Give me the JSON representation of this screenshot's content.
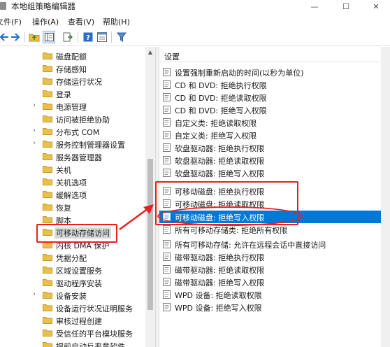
{
  "window": {
    "title": "本地组策略编辑器",
    "min_glyph": "—",
    "max_glyph": "☐",
    "close_glyph": "✕"
  },
  "menu": [
    {
      "label": "文件(F)"
    },
    {
      "label": "操作(A)"
    },
    {
      "label": "查看(V)"
    },
    {
      "label": "帮助(H)"
    }
  ],
  "toolbar": {
    "buttons": [
      "back-icon",
      "forward-icon",
      "up-folder-icon",
      "show-hide-tree-icon",
      "export-list-icon",
      "help-icon",
      "properties-icon",
      "filter-icon"
    ]
  },
  "tree": {
    "items": [
      {
        "label": "磁盘配额",
        "expandable": false
      },
      {
        "label": "存储感知",
        "expandable": false
      },
      {
        "label": "存储运行状况",
        "expandable": false
      },
      {
        "label": "登录",
        "expandable": false
      },
      {
        "label": "电源管理",
        "expandable": true
      },
      {
        "label": "访问被拒绝协助",
        "expandable": false
      },
      {
        "label": "分布式 COM",
        "expandable": true
      },
      {
        "label": "服务控制管理器设置",
        "expandable": true
      },
      {
        "label": "服务器管理器",
        "expandable": false
      },
      {
        "label": "关机",
        "expandable": false
      },
      {
        "label": "关机选项",
        "expandable": false
      },
      {
        "label": "缓解选项",
        "expandable": false
      },
      {
        "label": "恢复",
        "expandable": false
      },
      {
        "label": "脚本",
        "expandable": false
      },
      {
        "label": "可移动存储访问",
        "expandable": false,
        "selected": true
      },
      {
        "label": "内核 DMA 保护",
        "expandable": false
      },
      {
        "label": "凭据分配",
        "expandable": false
      },
      {
        "label": "区域设置服务",
        "expandable": false
      },
      {
        "label": "驱动程序安装",
        "expandable": false
      },
      {
        "label": "设备安装",
        "expandable": true
      },
      {
        "label": "设备运行状况证明服务",
        "expandable": false
      },
      {
        "label": "审核过程创建",
        "expandable": false
      },
      {
        "label": "受信任的平台模块服务",
        "expandable": false
      },
      {
        "label": "提前启动反恶意软件",
        "expandable": false
      }
    ]
  },
  "settings": {
    "header": "设置",
    "items": [
      {
        "label": "设置强制重新启动的时间(以秒为单位)"
      },
      {
        "label": "CD 和 DVD: 拒绝执行权限"
      },
      {
        "label": "CD 和 DVD: 拒绝读取权限"
      },
      {
        "label": "CD 和 DVD: 拒绝写入权限"
      },
      {
        "label": "自定义类: 拒绝读取权限"
      },
      {
        "label": "自定义类: 拒绝写入权限"
      },
      {
        "label": "软盘驱动器: 拒绝执行权限"
      },
      {
        "label": "软盘驱动器: 拒绝读取权限"
      },
      {
        "label": "软盘驱动器: 拒绝写入权限"
      },
      {
        "label": "可移动磁盘: 拒绝执行权限"
      },
      {
        "label": "可移动磁盘: 拒绝读取权限"
      },
      {
        "label": "可移动磁盘: 拒绝写入权限",
        "selected": true
      },
      {
        "label": "所有可移动存储类: 拒绝所有权限"
      },
      {
        "label": "所有可移动存储: 允许在远程会话中直接访问"
      },
      {
        "label": "磁带驱动器: 拒绝执行权限"
      },
      {
        "label": "磁带驱动器: 拒绝读取权限"
      },
      {
        "label": "磁带驱动器: 拒绝写入权限"
      },
      {
        "label": "WPD 设备: 拒绝读取权限"
      },
      {
        "label": "WPD 设备: 拒绝写入权限"
      }
    ]
  },
  "colors": {
    "selection": "#0078d7",
    "annotation": "#e8201e",
    "folder": "#e9c04a"
  }
}
